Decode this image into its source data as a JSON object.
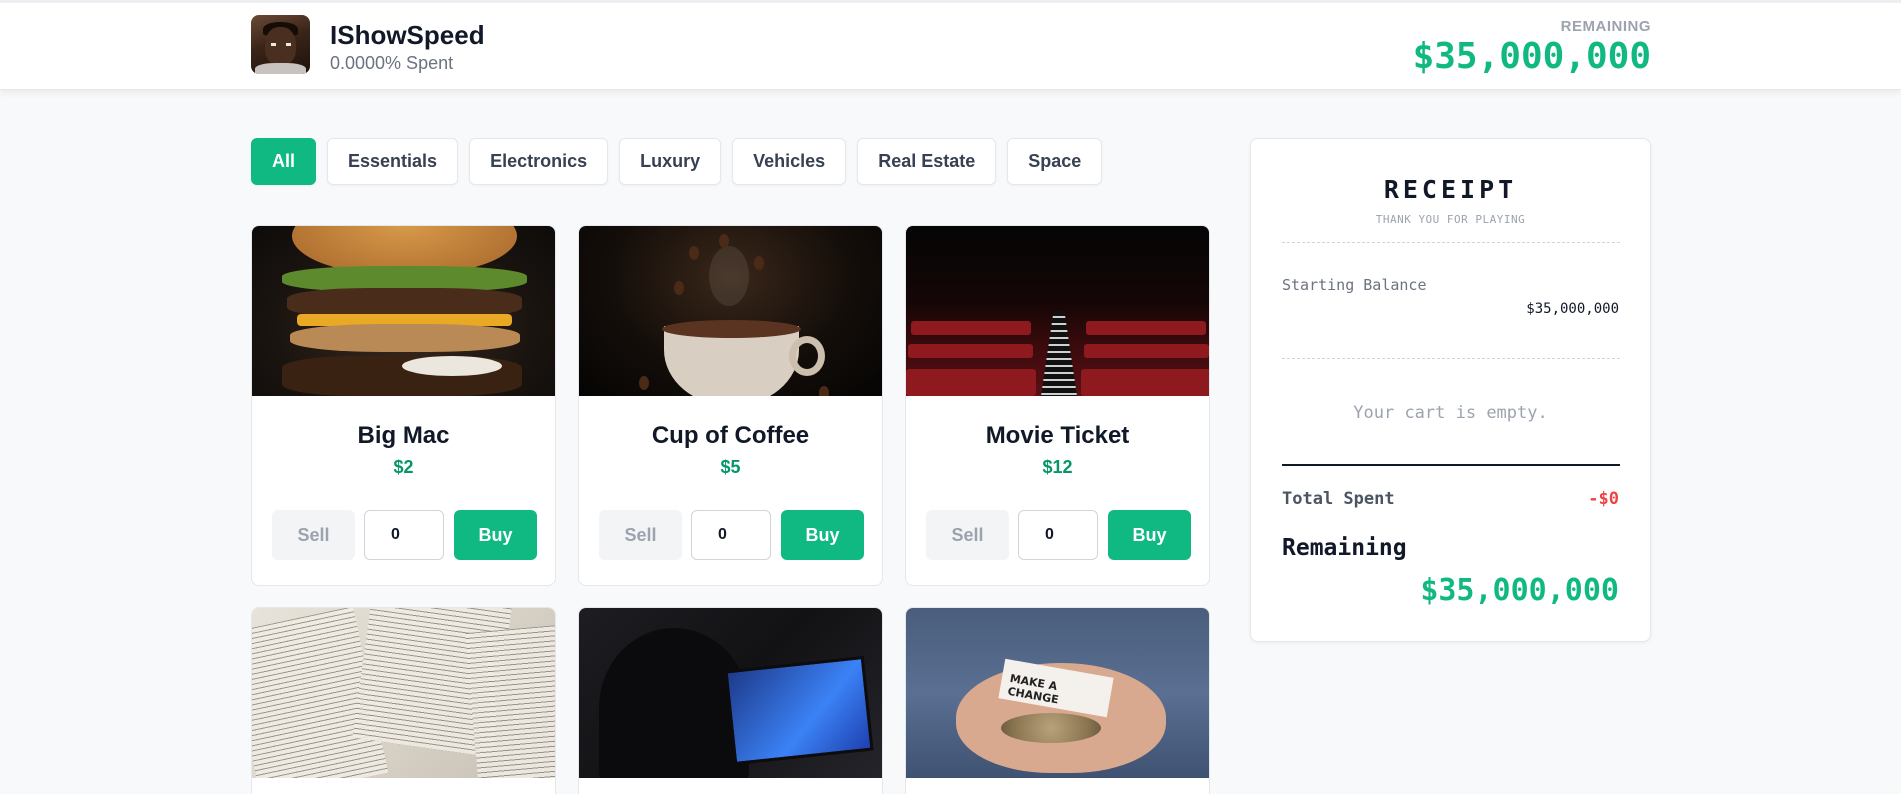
{
  "header": {
    "name": "IShowSpeed",
    "spent_text": "0.0000% Spent",
    "remaining_label": "REMAINING",
    "remaining_value": "$35,000,000"
  },
  "filters": [
    "All",
    "Essentials",
    "Electronics",
    "Luxury",
    "Vehicles",
    "Real Estate",
    "Space"
  ],
  "active_filter": "All",
  "products": [
    {
      "name": "Big Mac",
      "price": "$2",
      "quantity": "0",
      "sell_label": "Sell",
      "buy_label": "Buy",
      "image": "burger"
    },
    {
      "name": "Cup of Coffee",
      "price": "$5",
      "quantity": "0",
      "sell_label": "Sell",
      "buy_label": "Buy",
      "image": "coffee"
    },
    {
      "name": "Movie Ticket",
      "price": "$12",
      "quantity": "0",
      "sell_label": "Sell",
      "buy_label": "Buy",
      "image": "cinema-seats"
    },
    {
      "image": "books"
    },
    {
      "image": "gaming-setup"
    },
    {
      "image": "hands-with-coins",
      "image_text": "MAKE A CHANGE"
    }
  ],
  "receipt": {
    "title": "RECEIPT",
    "subtitle": "THANK YOU FOR PLAYING",
    "starting_balance_label": "Starting Balance",
    "starting_balance_value": "$35,000,000",
    "empty_text": "Your cart is empty.",
    "total_spent_label": "Total Spent",
    "total_spent_value": "-$0",
    "remaining_label": "Remaining",
    "remaining_value": "$35,000,000"
  },
  "colors": {
    "accent": "#10b981",
    "price": "#059669",
    "danger": "#ef4444",
    "background": "#f8f9fa"
  }
}
